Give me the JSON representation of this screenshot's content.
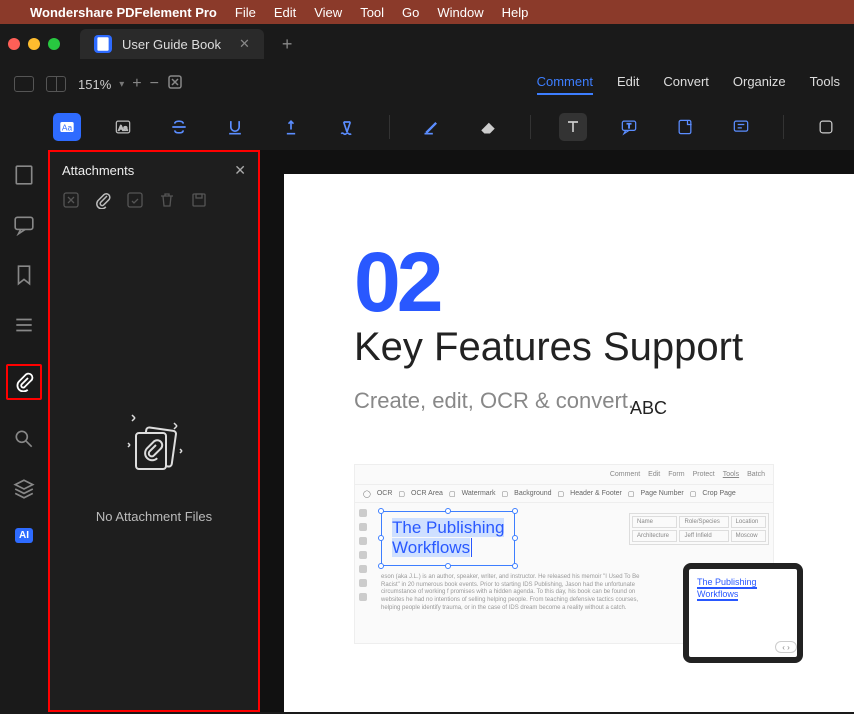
{
  "menubar": {
    "app_name": "Wondershare PDFelement Pro",
    "items": [
      "File",
      "Edit",
      "View",
      "Tool",
      "Go",
      "Window",
      "Help"
    ]
  },
  "tab": {
    "title": "User Guide Book"
  },
  "zoom": {
    "value": "151%"
  },
  "modes": {
    "comment": "Comment",
    "edit": "Edit",
    "convert": "Convert",
    "organize": "Organize",
    "tools": "Tools"
  },
  "sidebar": {
    "ai": "AI"
  },
  "panel": {
    "title": "Attachments",
    "empty": "No Attachment Files"
  },
  "page": {
    "num": "02",
    "abc": "ABC",
    "title": "Key Features Support",
    "sub": "Create, edit, OCR & convert."
  },
  "inner": {
    "modes": [
      "Comment",
      "Edit",
      "Form",
      "Protect",
      "Tools",
      "Batch"
    ],
    "tools": [
      "OCR",
      "OCR Area",
      "Watermark",
      "Background",
      "Header & Footer",
      "Page Number",
      "Crop Page"
    ],
    "headline1": "The Publishing",
    "headline2": "Workflows",
    "meta_h": [
      "Name",
      "Role/Species",
      "Location"
    ],
    "meta_r": [
      "Architecture",
      "Jeff Infield",
      "Moscow"
    ],
    "lorem": "eson (aka J.L.) is an author, speaker, writer, and instructor. He released his memoir \"I Used To Be Racist\" in 20 numerous book events. Prior to starting IDS Publishing, Jason had the unfortunate circumstance of working f promises with a hidden agenda. To this day, his book can be found on websites he had no intentions of selling helping people. From teaching defensive tactics courses, helping people identify trauma, or in the case of IDS dream become a reality without a catch.",
    "tablet_h1": "The Publishing",
    "tablet_h2": "Workflows"
  }
}
